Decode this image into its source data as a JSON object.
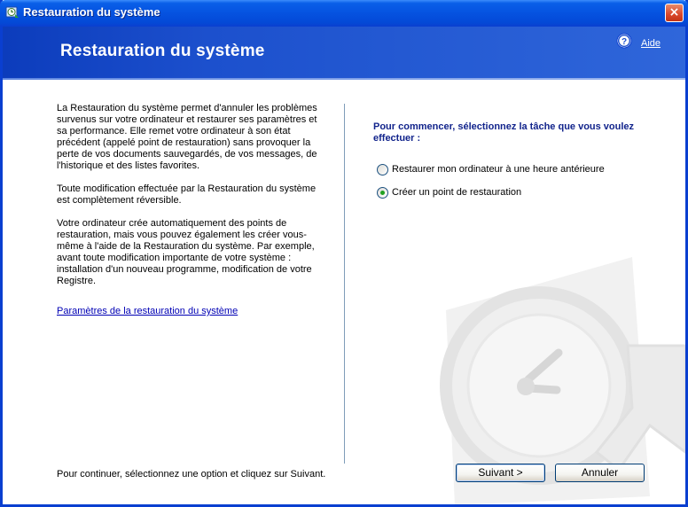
{
  "window": {
    "title": "Restauration du système",
    "close_label": "×"
  },
  "header": {
    "title": "Restauration du système",
    "help_link": "Aide"
  },
  "left_panel": {
    "paragraphs": [
      "La Restauration du système permet d'annuler les problèmes survenus sur votre ordinateur et restaurer ses paramètres et sa performance. Elle remet votre ordinateur à son état précédent (appelé point de restauration) sans provoquer la perte de vos documents sauvegardés, de vos messages, de l'historique et des listes favorites.",
      "Toute modification effectuée par la Restauration du système est complètement réversible.",
      "Votre ordinateur crée automatiquement des points de restauration, mais vous pouvez également les créer vous-même à l'aide de la Restauration du système. Par exemple, avant toute modification importante de votre système : installation d'un nouveau programme, modification de votre Registre."
    ],
    "settings_link": "Paramètres de la restauration du système"
  },
  "right_panel": {
    "instruction": "Pour commencer, sélectionnez la tâche que vous voulez effectuer :",
    "options": [
      {
        "label": "Restaurer mon ordinateur à une heure antérieure",
        "checked": false
      },
      {
        "label": "Créer un point de restauration",
        "checked": true
      }
    ]
  },
  "footer": {
    "hint": "Pour continuer, sélectionnez une option et cliquez sur Suivant.",
    "next_label": "Suivant >",
    "cancel_label": "Annuler"
  },
  "icons": {
    "title": "system-restore-icon",
    "help": "help-icon",
    "watermark": "clock-watermark-icon"
  },
  "colors": {
    "title_bar": "#0552e0",
    "header": "#1c50cd",
    "instruction_text": "#12248c",
    "link": "#0000b4",
    "radio_checked": "#21a121"
  }
}
